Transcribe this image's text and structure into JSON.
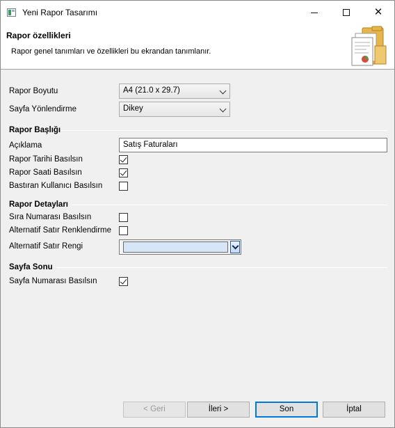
{
  "window": {
    "title": "Yeni Rapor Tasarımı",
    "controls": {
      "minimize_icon": "minimize-icon",
      "maximize_icon": "maximize-icon",
      "close_icon": "close-icon"
    }
  },
  "header": {
    "title": "Rapor özellikleri",
    "description": "Rapor genel tanımları ve özellikleri bu ekrandan tanımlanır.",
    "graphic_icon": "folder-documents-icon"
  },
  "form": {
    "rapor_boyutu": {
      "label": "Rapor Boyutu",
      "value": "A4 (21.0 x 29.7)"
    },
    "sayfa_yonlendirme": {
      "label": "Sayfa Yönlendirme",
      "value": "Dikey"
    },
    "sections": {
      "baslik": "Rapor Başlığı",
      "detaylar": "Rapor Detayları",
      "sayfa_sonu": "Sayfa Sonu"
    },
    "aciklama": {
      "label": "Açıklama",
      "value": "Satış Faturaları"
    },
    "rapor_tarihi": {
      "label": "Rapor Tarihi Basılsın",
      "checked": true
    },
    "rapor_saati": {
      "label": "Rapor Saati Basılsın",
      "checked": true
    },
    "bastiran_kullanici": {
      "label": "Bastıran Kullanıcı Basılsın",
      "checked": false
    },
    "sira_numarasi": {
      "label": "Sıra Numarası Basılsın",
      "checked": false
    },
    "alternatif_renklendirme": {
      "label": "Alternatif Satır Renklendirme",
      "checked": false
    },
    "alternatif_rengi": {
      "label": "Alternatif Satır Rengi",
      "color": "#d6e6f7"
    },
    "sayfa_numarasi": {
      "label": "Sayfa Numarası Basılsın",
      "checked": true
    }
  },
  "buttons": {
    "back": "< Geri",
    "next": "İleri >",
    "finish": "Son",
    "cancel": "İptal"
  },
  "colors": {
    "accent": "#0078d7",
    "header_bg": "#ffffff",
    "body_bg": "#f0f0f0"
  }
}
